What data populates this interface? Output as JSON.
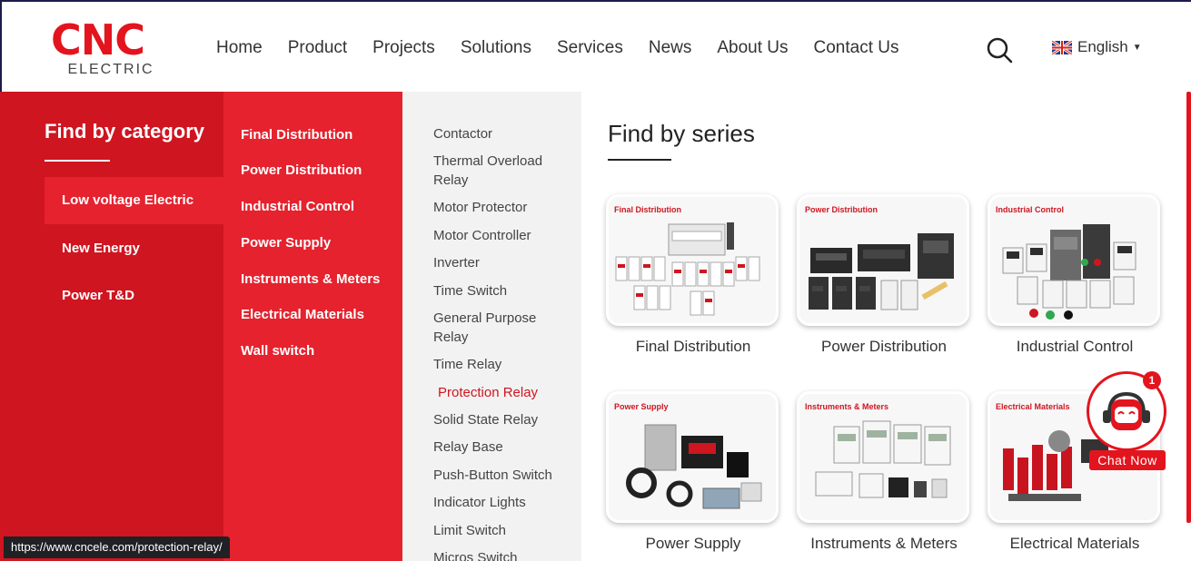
{
  "header": {
    "logo_main": "CNC",
    "logo_sub": "ELECTRIC",
    "nav": [
      "Home",
      "Product",
      "Projects",
      "Solutions",
      "Services",
      "News",
      "About Us",
      "Contact Us"
    ],
    "language": "English"
  },
  "menu": {
    "category_title": "Find by category",
    "categories": [
      "Low voltage Electric",
      "New Energy",
      "Power T&D"
    ],
    "subcategories": [
      "Final Distribution",
      "Power Distribution",
      "Industrial Control",
      "Power Supply",
      "Instruments & Meters",
      "Electrical Materials",
      "Wall switch"
    ],
    "products": [
      "Contactor",
      "Thermal Overload Relay",
      "Motor Protector",
      "Motor Controller",
      "Inverter",
      "Time Switch",
      "General Purpose Relay",
      "Time Relay",
      "Protection Relay",
      "Solid State Relay",
      "Relay Base",
      "Push-Button Switch",
      "Indicator Lights",
      "Limit Switch",
      "Micros Switch"
    ],
    "active_product": "Protection Relay"
  },
  "series": {
    "title": "Find by series",
    "cards": [
      {
        "label": "Final Distribution",
        "name": "Final Distribution"
      },
      {
        "label": "Power Distribution",
        "name": "Power Distribution"
      },
      {
        "label": "Industrial Control",
        "name": "Industrial Control"
      },
      {
        "label": "Power Supply",
        "name": "Power Supply"
      },
      {
        "label": "Instruments & Meters",
        "name": "Instruments & Meters"
      },
      {
        "label": "Electrical Materials",
        "name": "Electrical Materials"
      }
    ]
  },
  "chat": {
    "badge": "1",
    "label": "Chat Now"
  },
  "status_url": "https://www.cncele.com/protection-relay/",
  "colors": {
    "brand_red": "#e3141e",
    "dark_red": "#cf1520",
    "menu_gray": "#f2f2f2"
  }
}
